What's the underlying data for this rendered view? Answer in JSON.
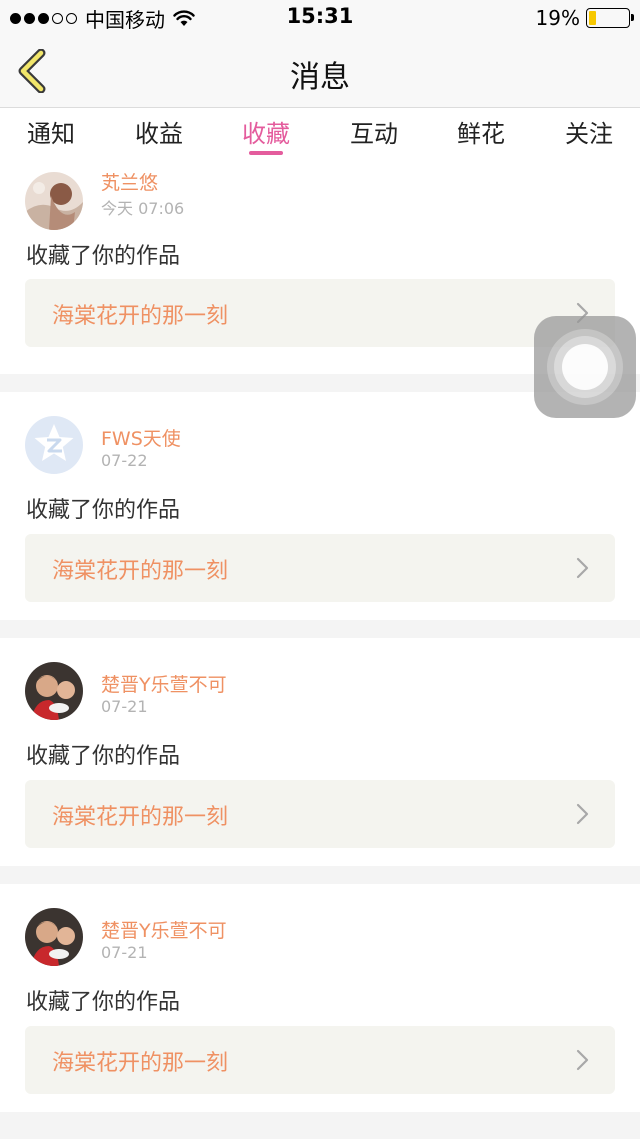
{
  "status_bar": {
    "carrier": "中国移动",
    "time": "15:31",
    "battery_percent_text": "19%",
    "battery_level": 0.19,
    "signal_bars_filled": 3,
    "signal_bars_total": 5
  },
  "nav": {
    "title": "消息",
    "back_icon": "chevron-left-icon"
  },
  "tabs": [
    {
      "label": "通知",
      "active": false
    },
    {
      "label": "收益",
      "active": false
    },
    {
      "label": "收藏",
      "active": true
    },
    {
      "label": "互动",
      "active": false
    },
    {
      "label": "鲜花",
      "active": false
    },
    {
      "label": "关注",
      "active": false
    }
  ],
  "messages": [
    {
      "user": "芄兰悠",
      "time": "今天 07:06",
      "action": "收藏了你的作品",
      "work": "海棠花开的那一刻",
      "avatar": "photo-avatar"
    },
    {
      "user": "FWS天使",
      "time": "07-22",
      "action": "收藏了你的作品",
      "work": "海棠花开的那一刻",
      "avatar": "default-avatar"
    },
    {
      "user": "楚晋Y乐萱不可",
      "time": "07-21",
      "action": "收藏了你的作品",
      "work": "海棠花开的那一刻",
      "avatar": "photo-avatar"
    },
    {
      "user": "楚晋Y乐萱不可",
      "time": "07-21",
      "action": "收藏了你的作品",
      "work": "海棠花开的那一刻",
      "avatar": "photo-avatar"
    }
  ],
  "colors": {
    "accent_pink": "#e45c9d",
    "name_orange": "#ef9163",
    "back_yellow": "#f2e66a"
  }
}
